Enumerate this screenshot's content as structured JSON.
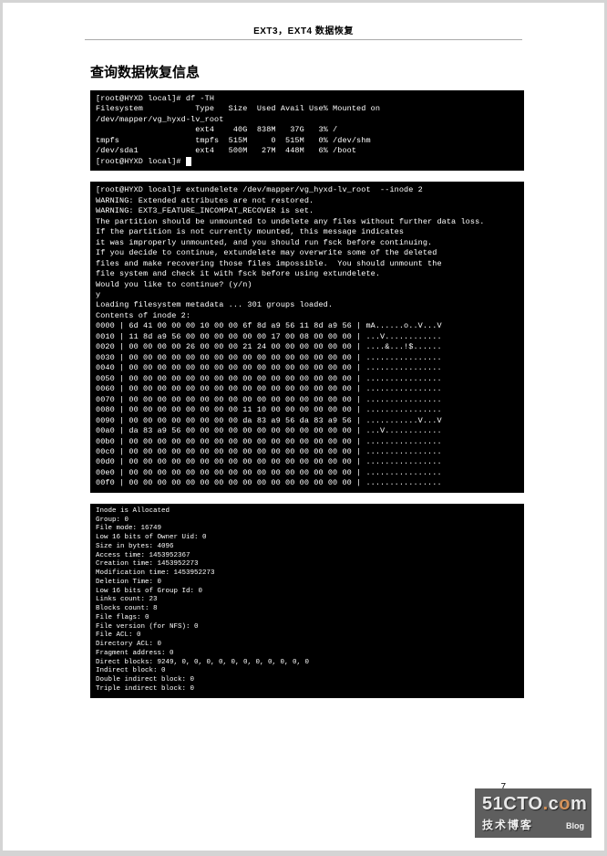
{
  "page_header": "EXT3，EXT4 数据恢复",
  "section_title": "查询数据恢复信息",
  "page_number": "7",
  "terminal1": "[root@HYXD local]# df -TH\nFilesystem           Type   Size  Used Avail Use% Mounted on\n/dev/mapper/vg_hyxd-lv_root\n                     ext4    40G  838M   37G   3% /\ntmpfs                tmpfs  515M     0  515M   0% /dev/shm\n/dev/sda1            ext4   500M   27M  448M   6% /boot\n[root@HYXD local]# ",
  "terminal2": "[root@HYXD local]# extundelete /dev/mapper/vg_hyxd-lv_root  --inode 2\nWARNING: Extended attributes are not restored.\nWARNING: EXT3_FEATURE_INCOMPAT_RECOVER is set.\nThe partition should be unmounted to undelete any files without further data loss.\nIf the partition is not currently mounted, this message indicates\nit was improperly unmounted, and you should run fsck before continuing.\nIf you decide to continue, extundelete may overwrite some of the deleted\nfiles and make recovering those files impossible.  You should unmount the\nfile system and check it with fsck before using extundelete.\nWould you like to continue? (y/n)\ny\nLoading filesystem metadata ... 301 groups loaded.\nContents of inode 2:\n0000 | 6d 41 00 00 00 10 00 00 6f 8d a9 56 11 8d a9 56 | mA......o..V...V\n0010 | 11 8d a9 56 00 00 00 00 00 00 17 00 08 00 00 00 | ...V............\n0020 | 00 00 00 00 26 00 00 00 21 24 00 00 00 00 00 00 | ....&...!$......\n0030 | 00 00 00 00 00 00 00 00 00 00 00 00 00 00 00 00 | ................\n0040 | 00 00 00 00 00 00 00 00 00 00 00 00 00 00 00 00 | ................\n0050 | 00 00 00 00 00 00 00 00 00 00 00 00 00 00 00 00 | ................\n0060 | 00 00 00 00 00 00 00 00 00 00 00 00 00 00 00 00 | ................\n0070 | 00 00 00 00 00 00 00 00 00 00 00 00 00 00 00 00 | ................\n0080 | 00 00 00 00 00 00 00 00 11 10 00 00 00 00 00 00 | ................\n0090 | 00 00 00 00 00 00 00 00 da 83 a9 56 da 83 a9 56 | ...........V...V\n00a0 | da 83 a9 56 00 00 00 00 00 00 00 00 00 00 00 00 | ...V............\n00b0 | 00 00 00 00 00 00 00 00 00 00 00 00 00 00 00 00 | ................\n00c0 | 00 00 00 00 00 00 00 00 00 00 00 00 00 00 00 00 | ................\n00d0 | 00 00 00 00 00 00 00 00 00 00 00 00 00 00 00 00 | ................\n00e0 | 00 00 00 00 00 00 00 00 00 00 00 00 00 00 00 00 | ................\n00f0 | 00 00 00 00 00 00 00 00 00 00 00 00 00 00 00 00 | ................",
  "terminal3": "Inode is Allocated\nGroup: 0\nFile mode: 16749\nLow 16 bits of Owner Uid: 0\nSize in bytes: 4096\nAccess time: 1453952367\nCreation time: 1453952273\nModification time: 1453952273\nDeletion Time: 0\nLow 16 bits of Group Id: 0\nLinks count: 23\nBlocks count: 8\nFile flags: 0\nFile version (for NFS): 0\nFile ACL: 0\nDirectory ACL: 0\nFragment address: 0\nDirect blocks: 9249, 0, 0, 0, 0, 0, 0, 0, 0, 0, 0, 0\nIndirect block: 0\nDouble indirect block: 0\nTriple indirect block: 0",
  "watermark": {
    "logo": "51CTO.com",
    "cn": "技术博客",
    "blog": "Blog"
  }
}
